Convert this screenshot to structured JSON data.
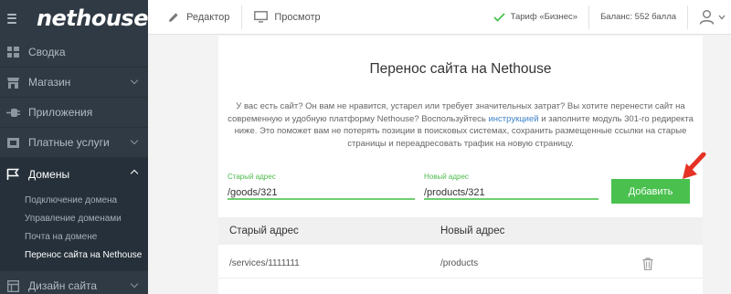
{
  "brand": {
    "logo": "nethouse"
  },
  "sidebar": {
    "items": [
      {
        "label": "Сводка",
        "icon": "dashboard-icon"
      },
      {
        "label": "Магазин",
        "icon": "shop-icon"
      },
      {
        "label": "Приложения",
        "icon": "plug-icon"
      },
      {
        "label": "Платные услуги",
        "icon": "wallet-icon"
      },
      {
        "label": "Домены",
        "icon": "flag-icon"
      },
      {
        "label": "Дизайн сайта",
        "icon": "layout-icon"
      }
    ],
    "submenu": [
      "Подключение домена",
      "Управление доменами",
      "Почта на домене",
      "Перенос сайта на Nethouse"
    ]
  },
  "topbar": {
    "editor": "Редактор",
    "preview": "Просмотр",
    "plan": "Тариф «Бизнес»",
    "balance": "Баланс: 552 балла"
  },
  "page": {
    "title": "Перенос сайта на Nethouse",
    "description_before_link": "У вас есть сайт? Он вам не нравится, устарел или требует значительных затрат? Вы хотите перенести сайт на современную и удобную платформу Nethouse? Воспользуйтесь ",
    "link_text": "инструкцией",
    "description_after_link": " и заполните модуль 301-го редиректа ниже. Это поможет вам не потерять позиции в поисковых системах, сохранить размещенные ссылки на старые страницы и переадресовать трафик на новую страницу."
  },
  "form": {
    "old_label": "Старый адрес",
    "old_value": "/goods/321",
    "new_label": "Новый адрес",
    "new_value": "/products/321",
    "add_button": "Добавить"
  },
  "table": {
    "headers": [
      "Старый адрес",
      "Новый адрес"
    ],
    "rows": [
      {
        "old": "/services/1111111",
        "new": "/products"
      }
    ]
  },
  "colors": {
    "sidebar": "#2f3a44",
    "accent_green": "#4ac14f",
    "link_blue": "#3d82c9",
    "arrow_red": "#e53224"
  }
}
